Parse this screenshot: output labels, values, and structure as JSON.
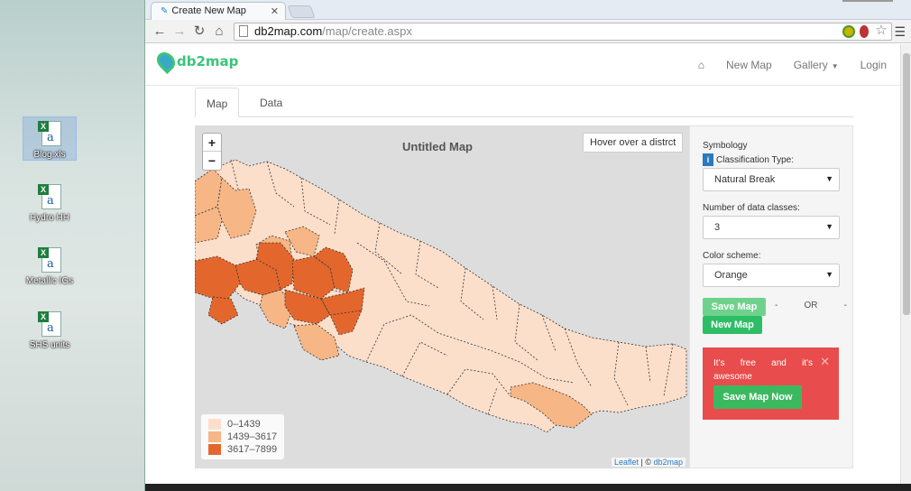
{
  "desktop": {
    "icons": [
      {
        "label": "Blog.xls"
      },
      {
        "label": "Hydro HH"
      },
      {
        "label": "Metallic IGs"
      },
      {
        "label": "SHS units"
      }
    ]
  },
  "browser": {
    "tab_title": "Create New Map",
    "url_host": "db2map.com",
    "url_path": "/map/create.aspx"
  },
  "site": {
    "logo_text": "db2map",
    "nav": {
      "new_map": "New Map",
      "gallery": "Gallery",
      "login": "Login"
    },
    "tabs": [
      {
        "label": "Map"
      },
      {
        "label": "Data"
      }
    ]
  },
  "map": {
    "title": "Untitled Map",
    "hover_text": "Hover over a distrct",
    "zoom_in": "+",
    "zoom_out": "−",
    "legend": [
      {
        "label": "0–1439",
        "color": "#fcdfcb"
      },
      {
        "label": "1439–3617",
        "color": "#f6b685"
      },
      {
        "label": "3617–7899",
        "color": "#e3672c"
      }
    ],
    "attribution_leaflet": "Leaflet",
    "attribution_sep": " | © ",
    "attribution_site": "db2map"
  },
  "panel": {
    "symbology_label": "Symbology",
    "classification_label": "Classification Type:",
    "classification_value": "Natural Break",
    "classes_label": "Number of data classes:",
    "classes_value": "3",
    "scheme_label": "Color scheme:",
    "scheme_value": "Orange",
    "save_button": "Save Map",
    "or_dash_left": "-",
    "or_text": "OR",
    "or_dash_right": "-",
    "new_button": "New Map",
    "promo_text": "It's free and it's awesome",
    "promo_button": "Save Map Now"
  }
}
